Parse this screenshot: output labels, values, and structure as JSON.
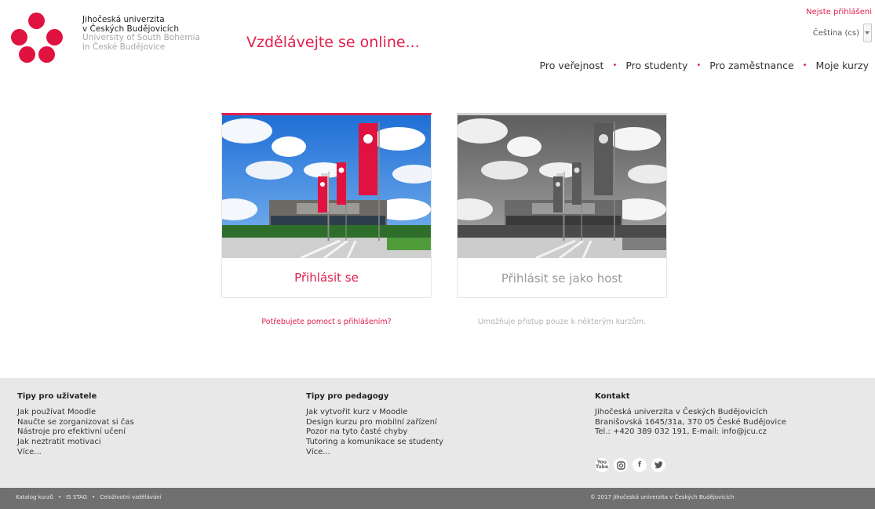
{
  "header": {
    "logo_line1": "Jihočeská univerzita",
    "logo_line2": "v Českých Budějovicích",
    "logo_line3": "University of South Bohemia",
    "logo_line4": "in České Budějovice",
    "tagline": "Vzdělávejte se online...",
    "login_status": "Nejste přihlášeni",
    "language": "Čeština (cs)",
    "nav": [
      "Pro veřejnost",
      "Pro studenty",
      "Pro zaměstnance",
      "Moje kurzy"
    ],
    "nav_separator": "•"
  },
  "cards": {
    "login_label": "Přihlásit se",
    "guest_label": "Přihlásit se jako host",
    "help_link": "Potřebujete pomoct s přihlášením?",
    "guest_note": "Umožňuje přístup pouze k některým kurzům."
  },
  "footer": {
    "col1": {
      "title": "Tipy pro uživatele",
      "items": [
        "Jak používat Moodle",
        "Naučte se zorganizovat si čas",
        "Nástroje pro efektivní učení",
        "Jak neztratit motivaci",
        "Více..."
      ]
    },
    "col2": {
      "title": "Tipy pro pedagogy",
      "items": [
        "Jak vytvořit kurz v Moodle",
        "Design kurzu pro mobilní zařízení",
        "Pozor na tyto časté chyby",
        "Tutoring a komunikace se studenty",
        "Více..."
      ]
    },
    "col3": {
      "title": "Kontakt",
      "lines": [
        "Jihočeská univerzita v Českých Budějovicích",
        "Branišovská 1645/31a, 370 05 České Budějovice",
        "Tel.: +420 389 032 191, E-mail: info@jcu.cz"
      ]
    },
    "social": [
      "You Tube",
      "instagram",
      "f",
      "twitter"
    ],
    "bottom_links": [
      "Katalog kurzů",
      "IS STAG",
      "Celoživotní vzdělávání"
    ],
    "bottom_separator": "•",
    "copyright": "© 2017 Jihočeská univerzita v Českých Budějovicích"
  },
  "colors": {
    "accent": "#e0214c",
    "logo_red": "#e0123f",
    "footer_bg": "#e8e8e8",
    "bottom_bar": "#707070"
  }
}
